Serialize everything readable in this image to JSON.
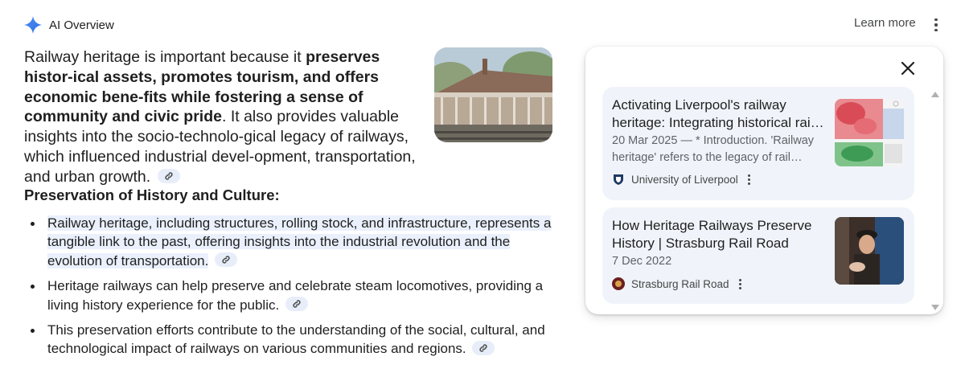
{
  "header": {
    "title": "AI Overview",
    "learn_more": "Learn more"
  },
  "intro": {
    "part1": "Railway heritage is important because it ",
    "bold": "preserves histor-ical assets, promotes tourism, and offers economic bene-fits while fostering a sense of community and civic pride",
    "part2": ". It also provides valuable insights into the socio-technolo-gical legacy of railways, which influenced industrial devel-opment, transportation, and urban growth."
  },
  "section": {
    "heading": "Preservation of History and Culture:",
    "bullets": [
      "Railway heritage, including structures, rolling stock, and infrastructure, represents a tangible link to the past, offering insights into the industrial revolution and the evolution of transportation.",
      "Heritage railways can help preserve and celebrate steam locomotives, providing a living history experience for the public.",
      "This preservation efforts contribute to the understanding of the social, cultural, and technological impact of railways on various communities and regions."
    ]
  },
  "sources": [
    {
      "title_line1": "Activating Liverpool's railway",
      "title_line2": "heritage: Integrating historical rai…",
      "snippet_line1": "20 Mar 2025 — * Introduction. 'Railway",
      "snippet_line2": "heritage' refers to the legacy of rail…",
      "source": "University of Liverpool"
    },
    {
      "title_line1": "How Heritage Railways Preserve",
      "title_line2": "History | Strasburg Rail Road",
      "date": "7 Dec 2022",
      "source": "Strasburg Rail Road"
    }
  ],
  "icons": {
    "spark": "gemini-sparkle-icon",
    "link": "link-icon",
    "more": "more-vert-icon",
    "close": "close-icon"
  },
  "colors": {
    "spark_blue": "#4285f4",
    "highlight": "#eaf0fc",
    "card_bg": "#f0f4fa",
    "chip_bg": "#e8eef9"
  }
}
